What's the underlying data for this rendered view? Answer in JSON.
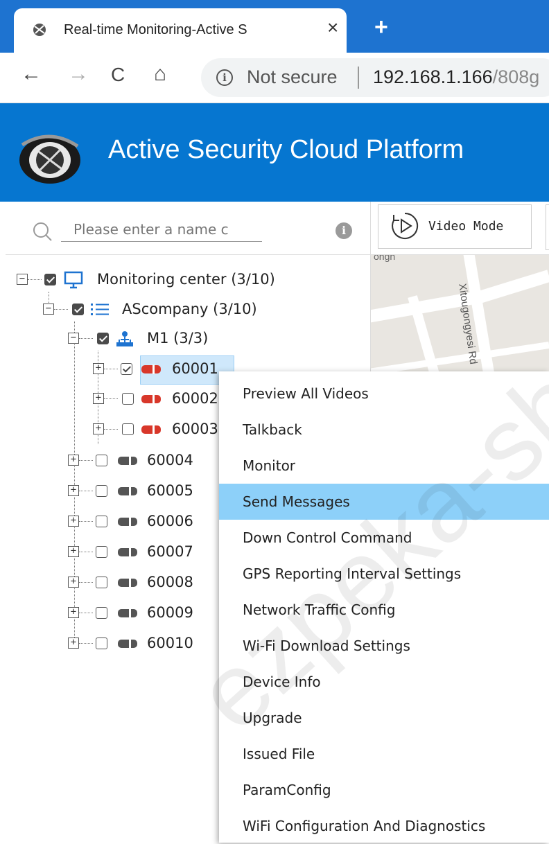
{
  "browser": {
    "tab_title": "Real-time Monitoring-Active S",
    "tab_close": "×",
    "new_tab": "+",
    "nav": {
      "back": "←",
      "forward": "→",
      "reload": "C",
      "home": "⌂"
    },
    "security_icon": "i",
    "security_text": "Not secure",
    "url_host": "192.168.1.166",
    "url_rest": "/808g"
  },
  "header": {
    "title": "Active Security Cloud Platform",
    "bg_color": "#0676d0"
  },
  "search": {
    "placeholder": "Please enter a name c",
    "info_icon": "i"
  },
  "toolbar": {
    "video_mode_label": "Video Mode"
  },
  "map": {
    "street_label": "Xitougongyesi Rd",
    "street_label_2": "ongn"
  },
  "tree": {
    "root": {
      "expander": "−",
      "label": "Monitoring center (3/10)"
    },
    "company": {
      "expander": "−",
      "label": "AScompany (3/10)"
    },
    "group": {
      "expander": "−",
      "label": "M1 (3/3)"
    },
    "vehicles": [
      {
        "expander": "+",
        "label": "60001",
        "checked": true,
        "color": "red"
      },
      {
        "expander": "+",
        "label": "60002",
        "checked": false,
        "color": "red"
      },
      {
        "expander": "+",
        "label": "60003",
        "checked": false,
        "color": "red"
      },
      {
        "expander": "+",
        "label": "60004",
        "checked": false,
        "color": "gray"
      },
      {
        "expander": "+",
        "label": "60005",
        "checked": false,
        "color": "gray"
      },
      {
        "expander": "+",
        "label": "60006",
        "checked": false,
        "color": "gray"
      },
      {
        "expander": "+",
        "label": "60007",
        "checked": false,
        "color": "gray"
      },
      {
        "expander": "+",
        "label": "60008",
        "checked": false,
        "color": "gray"
      },
      {
        "expander": "+",
        "label": "60009",
        "checked": false,
        "color": "gray"
      },
      {
        "expander": "+",
        "label": "60010",
        "checked": false,
        "color": "gray"
      }
    ]
  },
  "context_menu": {
    "highlighted": "Send Messages",
    "items": [
      "Preview All Videos",
      "Talkback",
      "Monitor",
      "Send Messages",
      "Down Control Command",
      "GPS Reporting Interval Settings",
      "Network Traffic Config",
      "Wi-Fi Download Settings",
      "Device Info",
      "Upgrade",
      "Issued File",
      "ParamConfig",
      "WiFi Configuration And Diagnostics"
    ]
  },
  "watermark": "ezpeka-sh",
  "colors": {
    "tab_bar": "#1e73d0",
    "menu_highlight": "#8dd0f9",
    "selection": "#cfe8fb",
    "vehicle_online": "#d8372a",
    "vehicle_offline": "#555555"
  }
}
